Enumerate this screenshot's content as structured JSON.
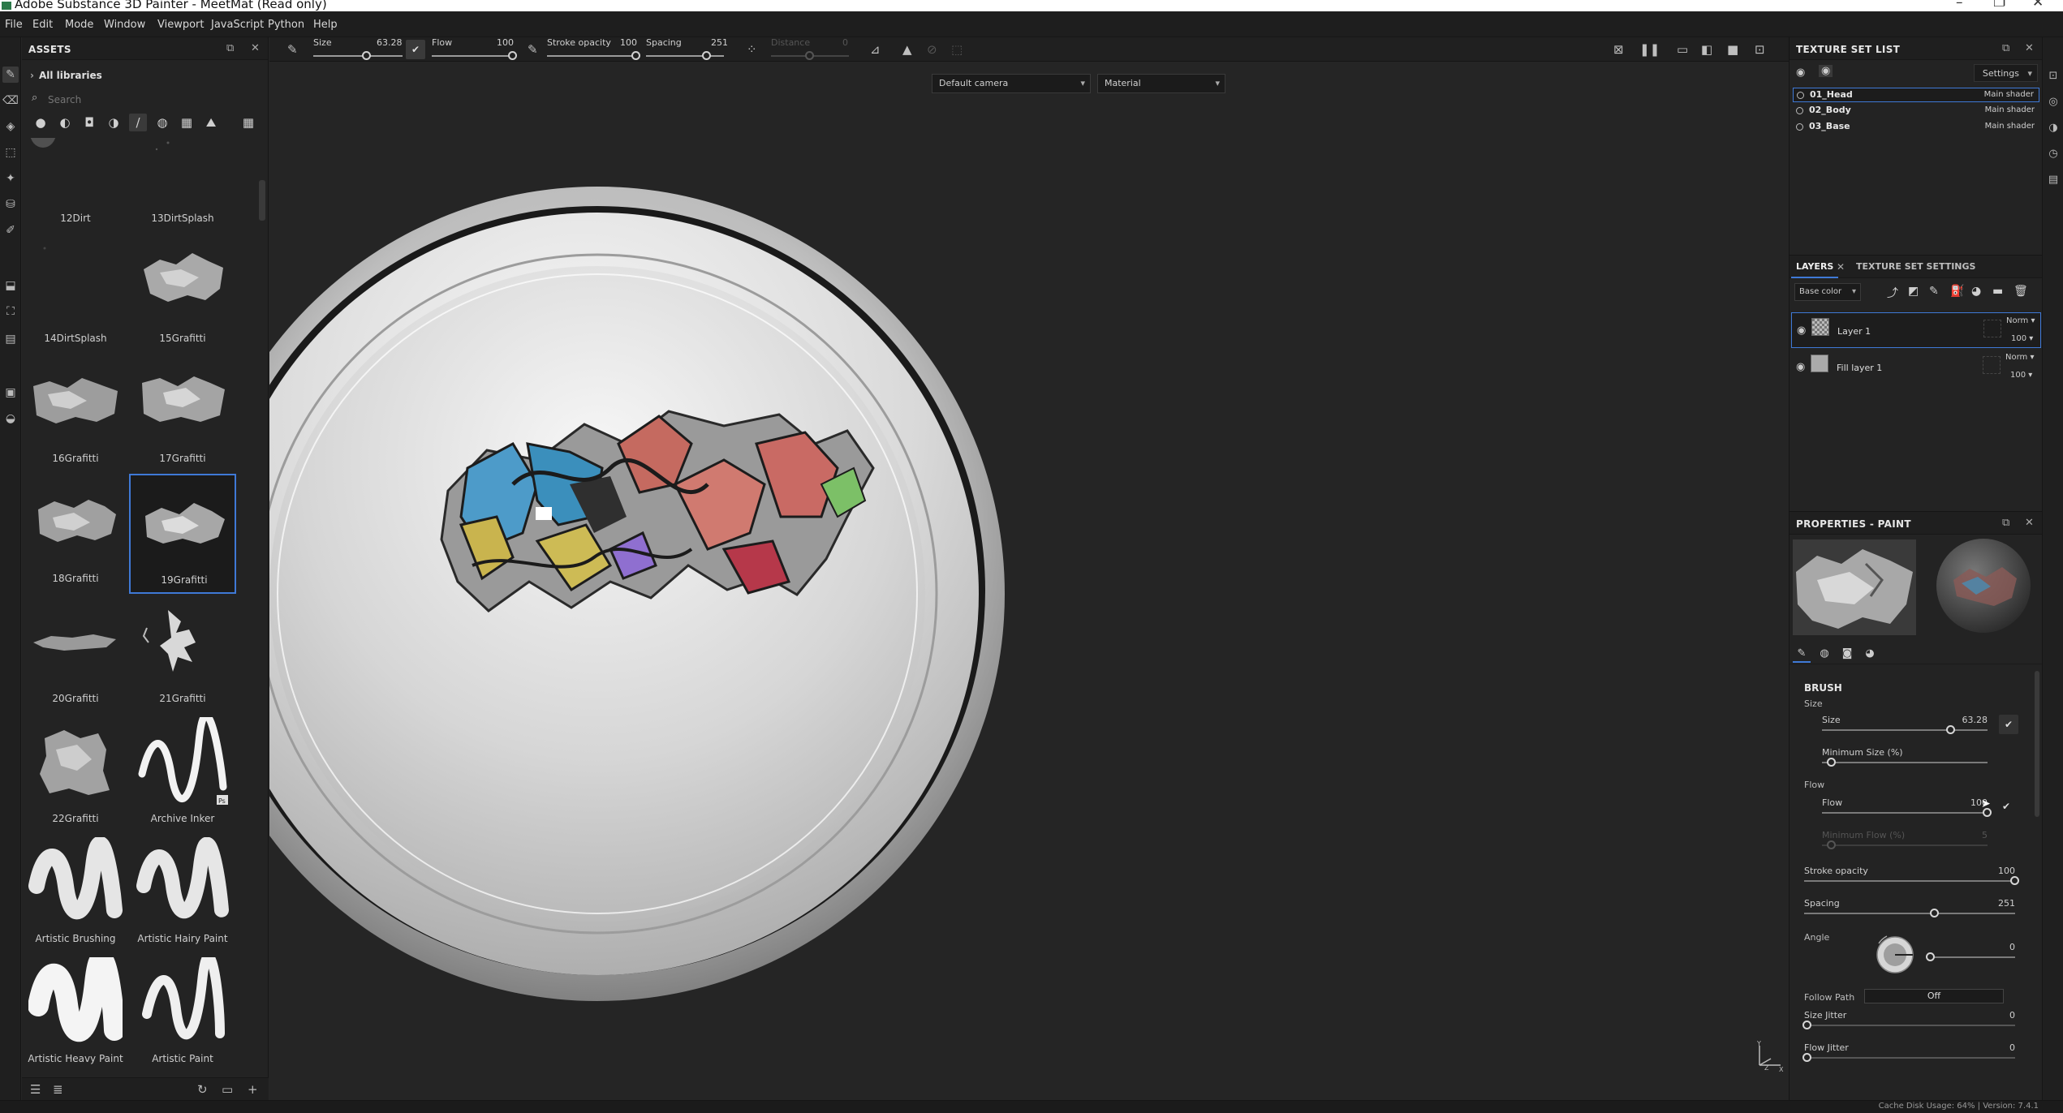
{
  "window": {
    "title": "Adobe Substance 3D Painter - MeetMat (Read only)",
    "controls": [
      "–",
      "❐",
      "✕"
    ]
  },
  "menu": [
    "File",
    "Edit",
    "Mode",
    "Window",
    "Viewport",
    "JavaScript",
    "Python",
    "Help"
  ],
  "assets": {
    "title": "ASSETS",
    "libraries_label": "All libraries",
    "search_placeholder": "Search",
    "items": [
      {
        "label": "12Dirt"
      },
      {
        "label": "13DirtSplash"
      },
      {
        "label": "14DirtSplash"
      },
      {
        "label": "15Grafitti"
      },
      {
        "label": "16Grafitti"
      },
      {
        "label": "17Grafitti"
      },
      {
        "label": "18Grafitti"
      },
      {
        "label": "19Grafitti",
        "selected": true
      },
      {
        "label": "20Grafitti"
      },
      {
        "label": "21Grafitti"
      },
      {
        "label": "22Grafitti"
      },
      {
        "label": "Archive Inker"
      },
      {
        "label": "Artistic Brushing"
      },
      {
        "label": "Artistic Hairy Paint"
      },
      {
        "label": "Artistic Heavy Paint"
      },
      {
        "label": "Artistic Paint"
      }
    ]
  },
  "toolbar": {
    "size_label": "Size",
    "size_value": "63.28",
    "size_fraction": 0.6,
    "flow_label": "Flow",
    "flow_value": "100",
    "flow_fraction": 1.0,
    "stroke_opacity_label": "Stroke opacity",
    "stroke_opacity_value": "100",
    "stroke_opacity_fraction": 1.0,
    "spacing_label": "Spacing",
    "spacing_value": "251",
    "spacing_fraction": 0.78,
    "distance_label": "Distance",
    "distance_value": "0",
    "distance_fraction": 0.5
  },
  "viewport": {
    "camera_label": "Default camera",
    "mode_label": "Material"
  },
  "texture_set_list": {
    "title": "TEXTURE SET LIST",
    "settings_label": "Settings",
    "sets": [
      {
        "name": "01_Head",
        "shader": "Main shader",
        "selected": true
      },
      {
        "name": "02_Body",
        "shader": "Main shader"
      },
      {
        "name": "03_Base",
        "shader": "Main shader"
      }
    ]
  },
  "layers": {
    "tab_layers": "LAYERS",
    "tab_settings": "TEXTURE SET SETTINGS",
    "channel": "Base color",
    "items": [
      {
        "name": "Layer 1",
        "blend": "Norm",
        "opacity": "100",
        "selected": true
      },
      {
        "name": "Fill layer 1",
        "blend": "Norm",
        "opacity": "100"
      }
    ]
  },
  "properties": {
    "title": "PROPERTIES - PAINT",
    "brush_header": "BRUSH",
    "size_group": "Size",
    "size_label": "Size",
    "size_value": "63.28",
    "size_fraction": 0.78,
    "min_size_label": "Minimum Size (%)",
    "min_size_fraction": 0.06,
    "flow_group": "Flow",
    "flow_label": "Flow",
    "flow_value": "100",
    "flow_fraction": 1.0,
    "min_flow_label": "Minimum Flow (%)",
    "min_flow_value": "5",
    "min_flow_fraction": 0.06,
    "stroke_opacity_label": "Stroke opacity",
    "stroke_opacity_value": "100",
    "stroke_opacity_fraction": 1.0,
    "spacing_label": "Spacing",
    "spacing_value": "251",
    "spacing_fraction": 0.62,
    "angle_label": "Angle",
    "angle_value": "0",
    "follow_path_label": "Follow Path",
    "follow_path_value": "Off",
    "size_jitter_label": "Size Jitter",
    "size_jitter_value": "0",
    "flow_jitter_label": "Flow Jitter",
    "flow_jitter_value": "0"
  },
  "statusbar": {
    "text": "Cache Disk Usage: 64% | Version: 7.4.1"
  },
  "colors": {
    "accent": "#3f79d6",
    "panel": "#232323",
    "viewport": "#252525"
  }
}
